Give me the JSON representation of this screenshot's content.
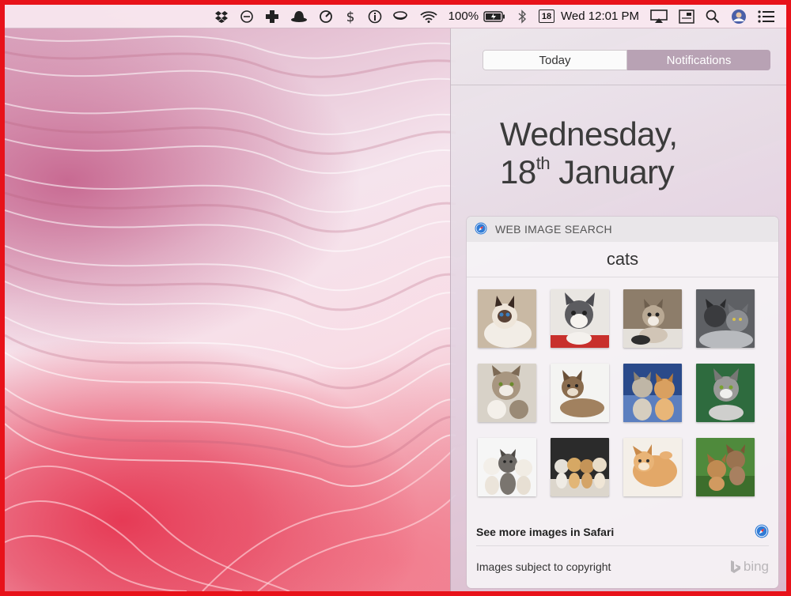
{
  "menubar": {
    "battery_percent": "100%",
    "date_badge": "18",
    "clock": "Wed 12:01 PM",
    "icons": [
      "dropbox-icon",
      "do-not-disturb-icon",
      "medical-cross-icon",
      "hat-icon",
      "speedometer-icon",
      "dollar-icon",
      "info-icon",
      "cup-icon",
      "wifi-icon",
      "battery-icon",
      "bluetooth-icon",
      "calendar-icon",
      "airplay-icon",
      "screen-icon",
      "spotlight-search-icon",
      "user-avatar-icon",
      "notification-center-icon"
    ]
  },
  "notification_center": {
    "tabs": [
      {
        "label": "Today",
        "selected": false
      },
      {
        "label": "Notifications",
        "selected": true
      }
    ],
    "date_line1": "Wednesday,",
    "date_day": "18",
    "date_suffix": "th",
    "date_month": "January",
    "widget": {
      "title": "WEB IMAGE SEARCH",
      "query": "cats",
      "image_count": 12,
      "more_link": "See more images in Safari",
      "copyright": "Images subject to copyright",
      "provider": "bing"
    }
  },
  "colors": {
    "frame_red": "#e8121a",
    "segment_selected": "#b8a2b4",
    "safari_blue": "#2f7bd6"
  }
}
